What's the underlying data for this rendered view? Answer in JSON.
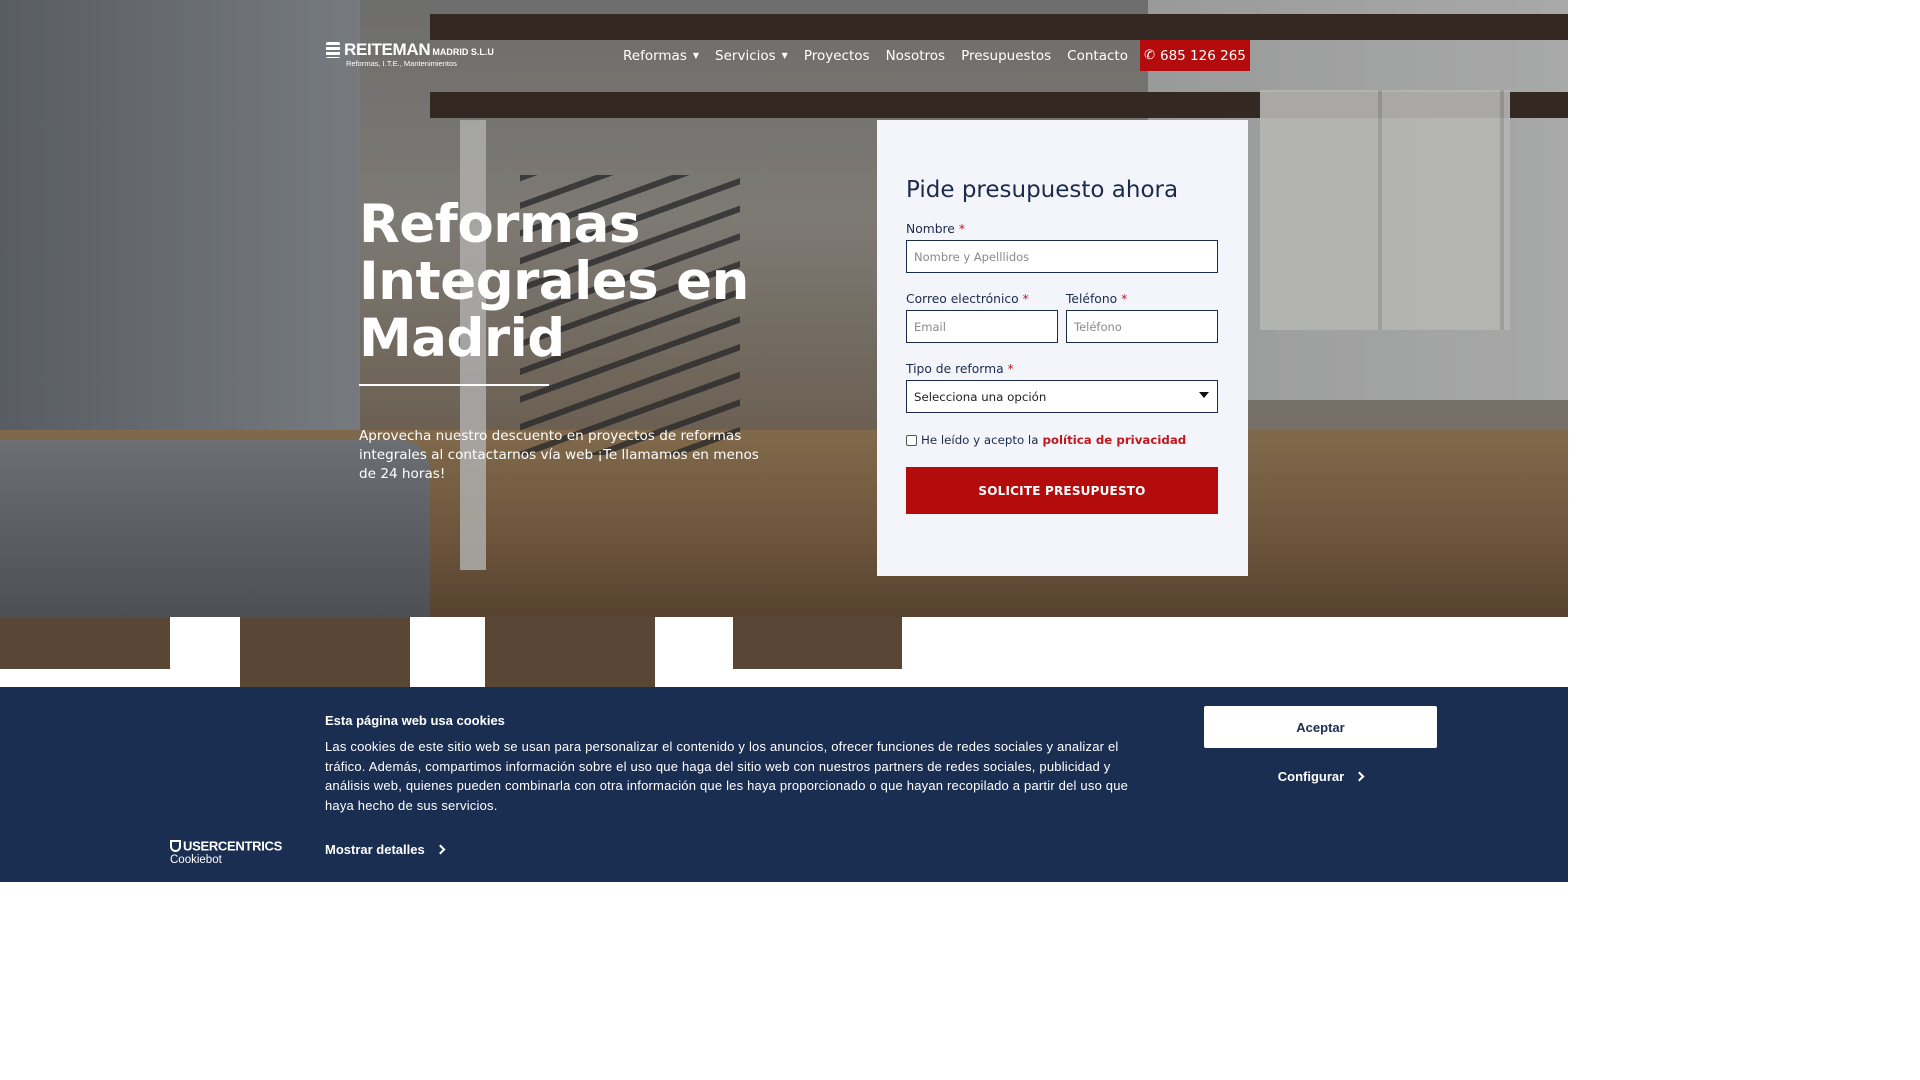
{
  "header": {
    "logo_name": "REITEMAN",
    "logo_suffix": "MADRID S.L.U",
    "logo_tagline": "Reformas, I.T.E., Mantenimientos",
    "nav": [
      {
        "label": "Reformas",
        "has_dropdown": true
      },
      {
        "label": "Servicios",
        "has_dropdown": true
      },
      {
        "label": "Proyectos"
      },
      {
        "label": "Nosotros"
      },
      {
        "label": "Presupuestos"
      },
      {
        "label": "Contacto"
      }
    ],
    "caret": "▼",
    "phone": "685 126 265",
    "phone_icon": "✆"
  },
  "hero": {
    "title": "Reformas Integrales en Madrid",
    "subtitle": "Aprovecha nuestro descuento en proyectos de reformas integrales al contactarnos vía web ¡Te llamamos en menos de 24 horas!"
  },
  "form": {
    "title": "Pide presupuesto ahora",
    "required_mark": "*",
    "name_label": "Nombre",
    "name_placeholder": "Nombre y Apelllidos",
    "email_label": "Correo electrónico",
    "email_placeholder": "Email",
    "phone_label": "Teléfono",
    "phone_placeholder": "Teléfono",
    "type_label": "Tipo de reforma",
    "type_selected": "Selecciona una opción",
    "consent_text": "He leído y acepto la",
    "consent_link": "política de privacidad",
    "submit": "SOLICITE PRESUPUESTO"
  },
  "cookie": {
    "title": "Esta página web usa cookies",
    "body": "Las cookies de este sitio web se usan para personalizar el contenido y los anuncios, ofrecer funciones de redes sociales y analizar el tráfico. Además, compartimos información sobre el uso que haga del sitio web con nuestros partners de redes sociales, publicidad y análisis web, quienes pueden combinarla con otra información que les haya proporcionado o que hayan recopilado a partir del uso que haya hecho de sus servicios.",
    "details": "Mostrar detalles",
    "accept": "Aceptar",
    "configure": "Configurar",
    "brand_top": "USERCENTRICS",
    "brand_bottom": "Cookiebot"
  },
  "colors": {
    "accent_red": "#b40c0c",
    "navy": "#1a2e52",
    "form_bg": "#f3f5fa"
  }
}
